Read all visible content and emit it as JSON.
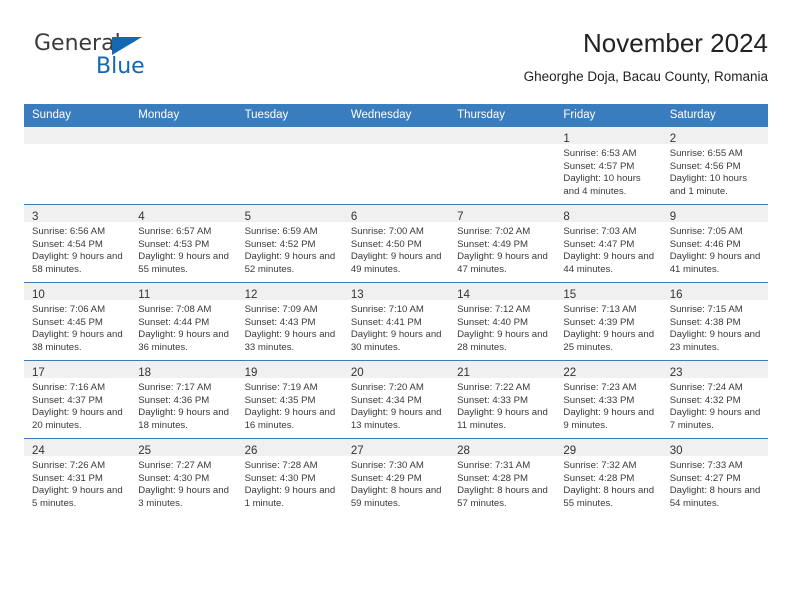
{
  "brand": {
    "name_part1": "General",
    "name_part2": "Blue",
    "logo_icon": "triangle-logo-icon"
  },
  "header": {
    "title": "November 2024",
    "subtitle": "Gheorghe Doja, Bacau County, Romania"
  },
  "colors": {
    "header_blue": "#3a7dbf",
    "brand_blue": "#1368b4",
    "daynum_band": "#f0f0f0"
  },
  "weekdays": [
    "Sunday",
    "Monday",
    "Tuesday",
    "Wednesday",
    "Thursday",
    "Friday",
    "Saturday"
  ],
  "labels": {
    "sunrise": "Sunrise:",
    "sunset": "Sunset:",
    "daylight": "Daylight:"
  },
  "weeks": [
    [
      {
        "day": "",
        "empty": true
      },
      {
        "day": "",
        "empty": true
      },
      {
        "day": "",
        "empty": true
      },
      {
        "day": "",
        "empty": true
      },
      {
        "day": "",
        "empty": true
      },
      {
        "day": "1",
        "sunrise": "Sunrise: 6:53 AM",
        "sunset": "Sunset: 4:57 PM",
        "daylight": "Daylight: 10 hours and 4 minutes."
      },
      {
        "day": "2",
        "sunrise": "Sunrise: 6:55 AM",
        "sunset": "Sunset: 4:56 PM",
        "daylight": "Daylight: 10 hours and 1 minute."
      }
    ],
    [
      {
        "day": "3",
        "sunrise": "Sunrise: 6:56 AM",
        "sunset": "Sunset: 4:54 PM",
        "daylight": "Daylight: 9 hours and 58 minutes."
      },
      {
        "day": "4",
        "sunrise": "Sunrise: 6:57 AM",
        "sunset": "Sunset: 4:53 PM",
        "daylight": "Daylight: 9 hours and 55 minutes."
      },
      {
        "day": "5",
        "sunrise": "Sunrise: 6:59 AM",
        "sunset": "Sunset: 4:52 PM",
        "daylight": "Daylight: 9 hours and 52 minutes."
      },
      {
        "day": "6",
        "sunrise": "Sunrise: 7:00 AM",
        "sunset": "Sunset: 4:50 PM",
        "daylight": "Daylight: 9 hours and 49 minutes."
      },
      {
        "day": "7",
        "sunrise": "Sunrise: 7:02 AM",
        "sunset": "Sunset: 4:49 PM",
        "daylight": "Daylight: 9 hours and 47 minutes."
      },
      {
        "day": "8",
        "sunrise": "Sunrise: 7:03 AM",
        "sunset": "Sunset: 4:47 PM",
        "daylight": "Daylight: 9 hours and 44 minutes."
      },
      {
        "day": "9",
        "sunrise": "Sunrise: 7:05 AM",
        "sunset": "Sunset: 4:46 PM",
        "daylight": "Daylight: 9 hours and 41 minutes."
      }
    ],
    [
      {
        "day": "10",
        "sunrise": "Sunrise: 7:06 AM",
        "sunset": "Sunset: 4:45 PM",
        "daylight": "Daylight: 9 hours and 38 minutes."
      },
      {
        "day": "11",
        "sunrise": "Sunrise: 7:08 AM",
        "sunset": "Sunset: 4:44 PM",
        "daylight": "Daylight: 9 hours and 36 minutes."
      },
      {
        "day": "12",
        "sunrise": "Sunrise: 7:09 AM",
        "sunset": "Sunset: 4:43 PM",
        "daylight": "Daylight: 9 hours and 33 minutes."
      },
      {
        "day": "13",
        "sunrise": "Sunrise: 7:10 AM",
        "sunset": "Sunset: 4:41 PM",
        "daylight": "Daylight: 9 hours and 30 minutes."
      },
      {
        "day": "14",
        "sunrise": "Sunrise: 7:12 AM",
        "sunset": "Sunset: 4:40 PM",
        "daylight": "Daylight: 9 hours and 28 minutes."
      },
      {
        "day": "15",
        "sunrise": "Sunrise: 7:13 AM",
        "sunset": "Sunset: 4:39 PM",
        "daylight": "Daylight: 9 hours and 25 minutes."
      },
      {
        "day": "16",
        "sunrise": "Sunrise: 7:15 AM",
        "sunset": "Sunset: 4:38 PM",
        "daylight": "Daylight: 9 hours and 23 minutes."
      }
    ],
    [
      {
        "day": "17",
        "sunrise": "Sunrise: 7:16 AM",
        "sunset": "Sunset: 4:37 PM",
        "daylight": "Daylight: 9 hours and 20 minutes."
      },
      {
        "day": "18",
        "sunrise": "Sunrise: 7:17 AM",
        "sunset": "Sunset: 4:36 PM",
        "daylight": "Daylight: 9 hours and 18 minutes."
      },
      {
        "day": "19",
        "sunrise": "Sunrise: 7:19 AM",
        "sunset": "Sunset: 4:35 PM",
        "daylight": "Daylight: 9 hours and 16 minutes."
      },
      {
        "day": "20",
        "sunrise": "Sunrise: 7:20 AM",
        "sunset": "Sunset: 4:34 PM",
        "daylight": "Daylight: 9 hours and 13 minutes."
      },
      {
        "day": "21",
        "sunrise": "Sunrise: 7:22 AM",
        "sunset": "Sunset: 4:33 PM",
        "daylight": "Daylight: 9 hours and 11 minutes."
      },
      {
        "day": "22",
        "sunrise": "Sunrise: 7:23 AM",
        "sunset": "Sunset: 4:33 PM",
        "daylight": "Daylight: 9 hours and 9 minutes."
      },
      {
        "day": "23",
        "sunrise": "Sunrise: 7:24 AM",
        "sunset": "Sunset: 4:32 PM",
        "daylight": "Daylight: 9 hours and 7 minutes."
      }
    ],
    [
      {
        "day": "24",
        "sunrise": "Sunrise: 7:26 AM",
        "sunset": "Sunset: 4:31 PM",
        "daylight": "Daylight: 9 hours and 5 minutes."
      },
      {
        "day": "25",
        "sunrise": "Sunrise: 7:27 AM",
        "sunset": "Sunset: 4:30 PM",
        "daylight": "Daylight: 9 hours and 3 minutes."
      },
      {
        "day": "26",
        "sunrise": "Sunrise: 7:28 AM",
        "sunset": "Sunset: 4:30 PM",
        "daylight": "Daylight: 9 hours and 1 minute."
      },
      {
        "day": "27",
        "sunrise": "Sunrise: 7:30 AM",
        "sunset": "Sunset: 4:29 PM",
        "daylight": "Daylight: 8 hours and 59 minutes."
      },
      {
        "day": "28",
        "sunrise": "Sunrise: 7:31 AM",
        "sunset": "Sunset: 4:28 PM",
        "daylight": "Daylight: 8 hours and 57 minutes."
      },
      {
        "day": "29",
        "sunrise": "Sunrise: 7:32 AM",
        "sunset": "Sunset: 4:28 PM",
        "daylight": "Daylight: 8 hours and 55 minutes."
      },
      {
        "day": "30",
        "sunrise": "Sunrise: 7:33 AM",
        "sunset": "Sunset: 4:27 PM",
        "daylight": "Daylight: 8 hours and 54 minutes."
      }
    ]
  ]
}
